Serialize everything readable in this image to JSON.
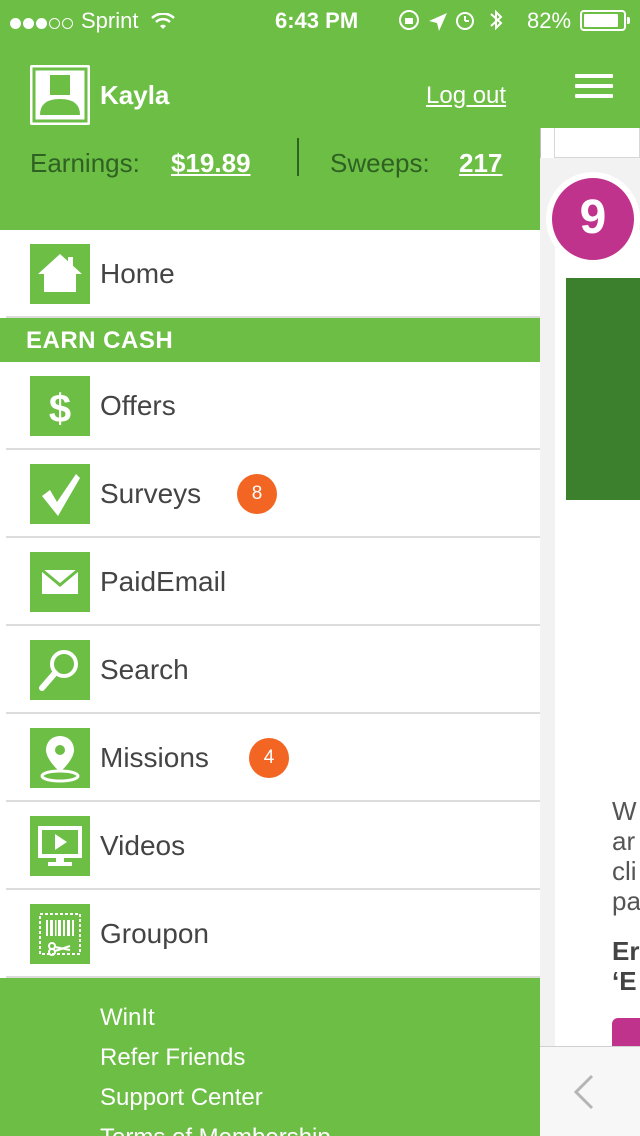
{
  "status_bar": {
    "carrier": "Sprint",
    "time": "6:43 PM",
    "battery": "82%"
  },
  "profile": {
    "name": "Kayla",
    "logout_label": "Log out",
    "earnings_label": "Earnings:",
    "earnings_value": "$19.89",
    "sweeps_label": "Sweeps:",
    "sweeps_value": "217"
  },
  "menu": {
    "home": {
      "label": "Home",
      "icon": "home-icon"
    },
    "section_title": "EARN CASH",
    "items": [
      {
        "label": "Offers",
        "icon": "dollar-icon",
        "badge": ""
      },
      {
        "label": "Surveys",
        "icon": "checkmark-icon",
        "badge": "8"
      },
      {
        "label": "PaidEmail",
        "icon": "envelope-icon",
        "badge": ""
      },
      {
        "label": "Search",
        "icon": "magnifier-icon",
        "badge": ""
      },
      {
        "label": "Missions",
        "icon": "map-pin-icon",
        "badge": "4"
      },
      {
        "label": "Videos",
        "icon": "video-screen-icon",
        "badge": ""
      },
      {
        "label": "Groupon",
        "icon": "coupon-icon",
        "badge": ""
      }
    ]
  },
  "footer": {
    "links": [
      "WinIt",
      "Refer Friends",
      "Support Center",
      "Terms of Membership"
    ]
  },
  "background": {
    "step_number": "9",
    "text_lines": [
      "W",
      "ar",
      "cli",
      "pa"
    ],
    "bold_lines": [
      "Er",
      "‘E"
    ]
  },
  "colors": {
    "brand_green": "#6cbe45",
    "dark_green": "#3c7f2d",
    "badge_orange": "#f26522",
    "accent_magenta": "#c0338d"
  }
}
